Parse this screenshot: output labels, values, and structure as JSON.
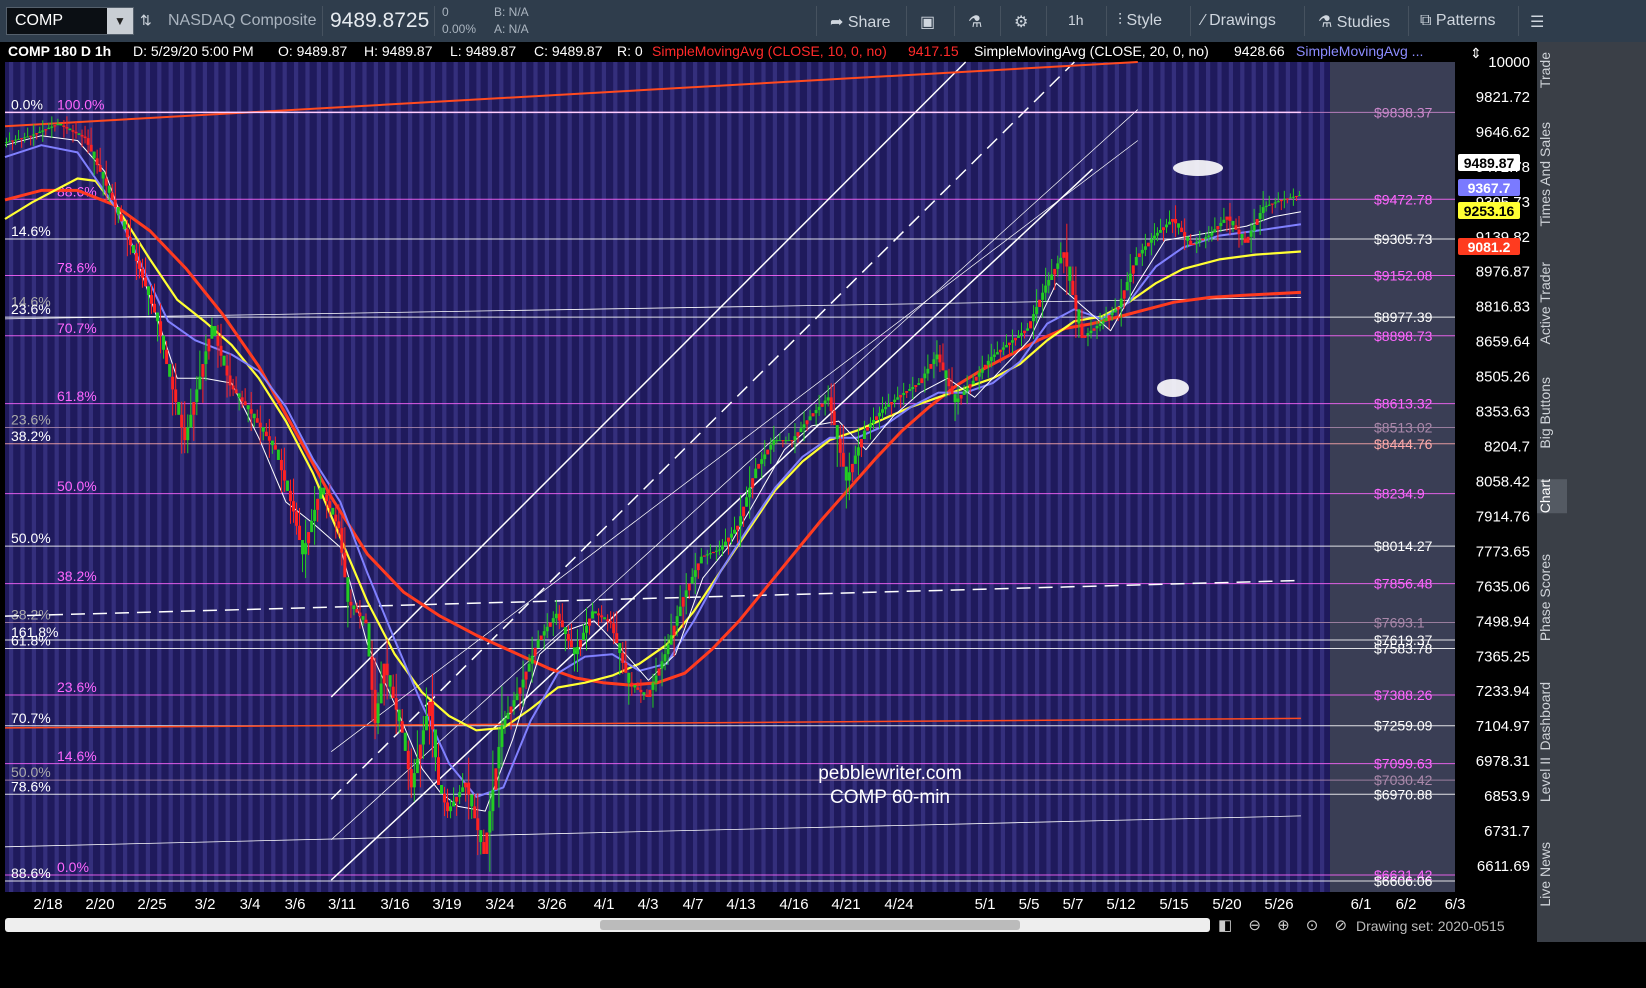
{
  "toolbar": {
    "symbol": "COMP",
    "name": "NASDAQ Composite",
    "price": "9489.8725",
    "change": "0",
    "change_pct": "0.00%",
    "bid": "B: N/A",
    "ask": "A: N/A",
    "share": "Share",
    "interval": "1h",
    "style": "Style",
    "drawings": "Drawings",
    "studies": "Studies",
    "patterns": "Patterns"
  },
  "infobar": {
    "series": "COMP 180 D 1h",
    "date": "D: 5/29/20 5:00 PM",
    "open": "O: 9489.87",
    "high": "H: 9489.87",
    "low": "L: 9489.87",
    "close": "C: 9489.87",
    "range": "R: 0",
    "sma10": "SimpleMovingAvg (CLOSE, 10, 0, no)",
    "sma10_val": "9417.15",
    "sma20": "SimpleMovingAvg (CLOSE, 20, 0, no)",
    "sma20_val": "9428.66",
    "sma_more": "SimpleMovingAvg ..."
  },
  "sidebar": [
    "Trade",
    "Times And Sales",
    "Active Trader",
    "Big Buttons",
    "Chart",
    "Phase Scores",
    "Dashboard",
    "Level II",
    "Live News"
  ],
  "bottombar": {
    "drawing_set": "Drawing set: 2020-0515"
  },
  "chart_data": {
    "type": "line",
    "watermark": [
      "pebblewriter.com",
      "COMP 60-min"
    ],
    "x_ticks": [
      "2/18",
      "2/20",
      "2/25",
      "3/2",
      "3/4",
      "3/6",
      "3/11",
      "3/16",
      "3/19",
      "3/24",
      "3/26",
      "4/1",
      "4/3",
      "4/7",
      "4/13",
      "4/16",
      "4/21",
      "4/24",
      "5/1",
      "5/5",
      "5/7",
      "5/12",
      "5/15",
      "5/20",
      "5/26",
      "6/1",
      "6/2",
      "6/3"
    ],
    "y_ticks": [
      "10000",
      "9821.72",
      "9646.62",
      "9472.78",
      "9305.73",
      "9139.82",
      "8976.87",
      "8816.83",
      "8659.64",
      "8505.26",
      "8353.63",
      "8204.7",
      "8058.42",
      "7914.76",
      "7773.65",
      "7635.06",
      "7498.94",
      "7365.25",
      "7233.94",
      "7104.97",
      "6978.31",
      "6853.9",
      "6731.7",
      "6611.69"
    ],
    "ylim": [
      6560,
      10050
    ],
    "price_labels": [
      {
        "label": "$9838.37",
        "value": 9838.37,
        "color": "#cc88cc"
      },
      {
        "label": "$9472.78",
        "value": 9472.78,
        "color": "#ff66ff"
      },
      {
        "label": "$9305.73",
        "value": 9305.73,
        "color": "#ffffff"
      },
      {
        "label": "$9152.08",
        "value": 9152.08,
        "color": "#ff66ff"
      },
      {
        "label": "$8977.39",
        "value": 8977.39,
        "color": "#ffffff"
      },
      {
        "label": "$8898.73",
        "value": 8898.73,
        "color": "#ff66ff"
      },
      {
        "label": "$8613.32",
        "value": 8613.32,
        "color": "#ff66ff"
      },
      {
        "label": "$8513.02",
        "value": 8513.02,
        "color": "#aa88aa"
      },
      {
        "label": "$8444.76",
        "value": 8444.76,
        "color": "#ffaaaa"
      },
      {
        "label": "$8234.9",
        "value": 8234.9,
        "color": "#ff66ff"
      },
      {
        "label": "$8014.27",
        "value": 8014.27,
        "color": "#ffffff"
      },
      {
        "label": "$7856.48",
        "value": 7856.48,
        "color": "#ff66ff"
      },
      {
        "label": "$7693.1",
        "value": 7693.1,
        "color": "#aa88aa"
      },
      {
        "label": "$7619.37",
        "value": 7619.37,
        "color": "#ffffff"
      },
      {
        "label": "$7583.78",
        "value": 7583.78,
        "color": "#ffffff"
      },
      {
        "label": "$7388.26",
        "value": 7388.26,
        "color": "#ff66ff"
      },
      {
        "label": "$7259.09",
        "value": 7259.09,
        "color": "#ffffff"
      },
      {
        "label": "$7099.63",
        "value": 7099.63,
        "color": "#ff66ff"
      },
      {
        "label": "$7030.42",
        "value": 7030.42,
        "color": "#aa88aa"
      },
      {
        "label": "$6970.88",
        "value": 6970.88,
        "color": "#ffffff"
      },
      {
        "label": "$6631.42",
        "value": 6631.42,
        "color": "#ff66ff"
      },
      {
        "label": "$6606.06",
        "value": 6606.06,
        "color": "#ffffff"
      }
    ],
    "fib_labels": [
      {
        "label": "0.0%",
        "value": 9838,
        "color": "#ffffff"
      },
      {
        "label": "100.0%",
        "value": 9838,
        "color": "#ff66ff"
      },
      {
        "label": "88.6%",
        "value": 9472,
        "color": "#ff66ff"
      },
      {
        "label": "14.6%",
        "value": 9305,
        "color": "#ffffff"
      },
      {
        "label": "78.6%",
        "value": 9152,
        "color": "#ff66ff"
      },
      {
        "label": "14.6%",
        "value": 9010,
        "color": "#aaaaaa"
      },
      {
        "label": "23.6%",
        "value": 8977,
        "color": "#ffffff"
      },
      {
        "label": "70.7%",
        "value": 8898,
        "color": "#ff66ff"
      },
      {
        "label": "61.8%",
        "value": 8613,
        "color": "#ff66ff"
      },
      {
        "label": "23.6%",
        "value": 8513,
        "color": "#aaaaaa"
      },
      {
        "label": "38.2%",
        "value": 8444,
        "color": "#ffffff"
      },
      {
        "label": "50.0%",
        "value": 8234,
        "color": "#ff66ff"
      },
      {
        "label": "50.0%",
        "value": 8014,
        "color": "#ffffff"
      },
      {
        "label": "38.2%",
        "value": 7856,
        "color": "#ff66ff"
      },
      {
        "label": "38.2%",
        "value": 7693,
        "color": "#aaaaaa"
      },
      {
        "label": "161.8%",
        "value": 7619,
        "color": "#ffffff"
      },
      {
        "label": "61.8%",
        "value": 7583,
        "color": "#ffffff"
      },
      {
        "label": "23.6%",
        "value": 7388,
        "color": "#ff66ff"
      },
      {
        "label": "70.7%",
        "value": 7259,
        "color": "#ffffff"
      },
      {
        "label": "14.6%",
        "value": 7099,
        "color": "#ff66ff"
      },
      {
        "label": "50.0%",
        "value": 7030,
        "color": "#aaaaaa"
      },
      {
        "label": "78.6%",
        "value": 6970,
        "color": "#ffffff"
      },
      {
        "label": "0.0%",
        "value": 6631,
        "color": "#ff66ff"
      },
      {
        "label": "88.6%",
        "value": 6606,
        "color": "#ffffff"
      }
    ],
    "badges": [
      {
        "label": "9489.87",
        "value": 9489.87,
        "bg": "#ffffff",
        "fg": "#000000"
      },
      {
        "label": "9367.7",
        "value": 9367.7,
        "bg": "#7a7aff",
        "fg": "#ffffff"
      },
      {
        "label": "9253.16",
        "value": 9253.16,
        "bg": "#ffff33",
        "fg": "#000000"
      },
      {
        "label": "9081.2",
        "value": 9081.2,
        "bg": "#ff3b1f",
        "fg": "#ffffff"
      }
    ],
    "price_series": [
      [
        0,
        9710
      ],
      [
        3,
        9740
      ],
      [
        6,
        9790
      ],
      [
        9,
        9730
      ],
      [
        11,
        9560
      ],
      [
        13,
        9380
      ],
      [
        15,
        9180
      ],
      [
        17,
        8960
      ],
      [
        18,
        8780
      ],
      [
        20,
        8460
      ],
      [
        22,
        8780
      ],
      [
        23,
        8940
      ],
      [
        25,
        8690
      ],
      [
        27,
        8590
      ],
      [
        30,
        8420
      ],
      [
        32,
        8160
      ],
      [
        33,
        7980
      ],
      [
        35,
        8260
      ],
      [
        37,
        8090
      ],
      [
        38,
        7780
      ],
      [
        40,
        7690
      ],
      [
        41,
        7270
      ],
      [
        42,
        7520
      ],
      [
        44,
        7230
      ],
      [
        45,
        7000
      ],
      [
        47,
        7360
      ],
      [
        48,
        7010
      ],
      [
        49,
        6900
      ],
      [
        51,
        7020
      ],
      [
        53,
        6720
      ],
      [
        55,
        7260
      ],
      [
        57,
        7420
      ],
      [
        59,
        7620
      ],
      [
        61,
        7730
      ],
      [
        63,
        7560
      ],
      [
        65,
        7740
      ],
      [
        67,
        7690
      ],
      [
        69,
        7440
      ],
      [
        71,
        7380
      ],
      [
        73,
        7560
      ],
      [
        75,
        7800
      ],
      [
        77,
        7970
      ],
      [
        79,
        8000
      ],
      [
        81,
        8100
      ],
      [
        83,
        8340
      ],
      [
        85,
        8460
      ],
      [
        87,
        8460
      ],
      [
        89,
        8560
      ],
      [
        91,
        8640
      ],
      [
        93,
        8290
      ],
      [
        95,
        8500
      ],
      [
        97,
        8590
      ],
      [
        99,
        8650
      ],
      [
        101,
        8700
      ],
      [
        103,
        8820
      ],
      [
        105,
        8620
      ],
      [
        107,
        8710
      ],
      [
        109,
        8810
      ],
      [
        111,
        8870
      ],
      [
        113,
        8930
      ],
      [
        115,
        9110
      ],
      [
        117,
        9250
      ],
      [
        119,
        8890
      ],
      [
        121,
        8950
      ],
      [
        123,
        9020
      ],
      [
        125,
        9230
      ],
      [
        127,
        9320
      ],
      [
        129,
        9390
      ],
      [
        131,
        9280
      ],
      [
        133,
        9320
      ],
      [
        135,
        9400
      ],
      [
        137,
        9290
      ],
      [
        139,
        9440
      ],
      [
        141,
        9470
      ],
      [
        143,
        9490
      ]
    ],
    "sma_fast": [
      [
        0,
        9700
      ],
      [
        4,
        9740
      ],
      [
        8,
        9720
      ],
      [
        11,
        9590
      ],
      [
        14,
        9280
      ],
      [
        17,
        8950
      ],
      [
        19,
        8720
      ],
      [
        22,
        8720
      ],
      [
        25,
        8700
      ],
      [
        28,
        8470
      ],
      [
        31,
        8200
      ],
      [
        34,
        8110
      ],
      [
        37,
        8010
      ],
      [
        40,
        7600
      ],
      [
        43,
        7350
      ],
      [
        46,
        7080
      ],
      [
        48,
        6980
      ],
      [
        50,
        6920
      ],
      [
        53,
        6900
      ],
      [
        56,
        7200
      ],
      [
        59,
        7560
      ],
      [
        62,
        7660
      ],
      [
        65,
        7700
      ],
      [
        68,
        7580
      ],
      [
        71,
        7450
      ],
      [
        74,
        7560
      ],
      [
        77,
        7880
      ],
      [
        80,
        8020
      ],
      [
        83,
        8220
      ],
      [
        86,
        8420
      ],
      [
        89,
        8520
      ],
      [
        92,
        8540
      ],
      [
        95,
        8420
      ],
      [
        98,
        8560
      ],
      [
        101,
        8660
      ],
      [
        104,
        8720
      ],
      [
        107,
        8640
      ],
      [
        110,
        8760
      ],
      [
        113,
        8880
      ],
      [
        116,
        9120
      ],
      [
        119,
        9020
      ],
      [
        122,
        8920
      ],
      [
        125,
        9120
      ],
      [
        128,
        9300
      ],
      [
        131,
        9320
      ],
      [
        134,
        9340
      ],
      [
        137,
        9360
      ],
      [
        140,
        9400
      ],
      [
        143,
        9420
      ]
    ],
    "sma_20": [
      [
        0,
        9650
      ],
      [
        4,
        9700
      ],
      [
        8,
        9670
      ],
      [
        12,
        9450
      ],
      [
        15,
        9200
      ],
      [
        18,
        8960
      ],
      [
        21,
        8880
      ],
      [
        25,
        8820
      ],
      [
        28,
        8750
      ],
      [
        31,
        8600
      ],
      [
        34,
        8380
      ],
      [
        37,
        8200
      ],
      [
        40,
        7900
      ],
      [
        43,
        7620
      ],
      [
        46,
        7350
      ],
      [
        49,
        7100
      ],
      [
        52,
        6960
      ],
      [
        55,
        7000
      ],
      [
        58,
        7280
      ],
      [
        61,
        7480
      ],
      [
        64,
        7550
      ],
      [
        67,
        7560
      ],
      [
        70,
        7490
      ],
      [
        73,
        7520
      ],
      [
        76,
        7700
      ],
      [
        79,
        7910
      ],
      [
        82,
        8090
      ],
      [
        85,
        8260
      ],
      [
        88,
        8390
      ],
      [
        91,
        8470
      ],
      [
        94,
        8470
      ],
      [
        97,
        8520
      ],
      [
        100,
        8600
      ],
      [
        103,
        8660
      ],
      [
        106,
        8660
      ],
      [
        109,
        8700
      ],
      [
        112,
        8790
      ],
      [
        115,
        8950
      ],
      [
        118,
        9010
      ],
      [
        121,
        8970
      ],
      [
        124,
        9040
      ],
      [
        127,
        9190
      ],
      [
        130,
        9270
      ],
      [
        134,
        9320
      ],
      [
        138,
        9340
      ],
      [
        143,
        9368
      ]
    ],
    "sma_yellow": [
      [
        0,
        9390
      ],
      [
        3,
        9460
      ],
      [
        6,
        9520
      ],
      [
        8,
        9560
      ],
      [
        10,
        9550
      ],
      [
        13,
        9400
      ],
      [
        16,
        9220
      ],
      [
        19,
        9050
      ],
      [
        22,
        8960
      ],
      [
        25,
        8860
      ],
      [
        28,
        8720
      ],
      [
        31,
        8540
      ],
      [
        34,
        8320
      ],
      [
        37,
        8050
      ],
      [
        40,
        7780
      ],
      [
        43,
        7560
      ],
      [
        46,
        7400
      ],
      [
        49,
        7300
      ],
      [
        52,
        7240
      ],
      [
        55,
        7250
      ],
      [
        58,
        7330
      ],
      [
        61,
        7420
      ],
      [
        64,
        7440
      ],
      [
        67,
        7470
      ],
      [
        70,
        7520
      ],
      [
        73,
        7600
      ],
      [
        76,
        7740
      ],
      [
        79,
        7910
      ],
      [
        82,
        8080
      ],
      [
        85,
        8250
      ],
      [
        88,
        8370
      ],
      [
        91,
        8460
      ],
      [
        94,
        8500
      ],
      [
        97,
        8550
      ],
      [
        100,
        8600
      ],
      [
        103,
        8640
      ],
      [
        106,
        8680
      ],
      [
        109,
        8720
      ],
      [
        112,
        8780
      ],
      [
        115,
        8880
      ],
      [
        118,
        8960
      ],
      [
        121,
        8980
      ],
      [
        124,
        9040
      ],
      [
        127,
        9120
      ],
      [
        130,
        9180
      ],
      [
        134,
        9220
      ],
      [
        138,
        9240
      ],
      [
        143,
        9253
      ]
    ],
    "sma_red": [
      [
        0,
        9470
      ],
      [
        4,
        9510
      ],
      [
        8,
        9510
      ],
      [
        12,
        9450
      ],
      [
        16,
        9340
      ],
      [
        20,
        9180
      ],
      [
        24,
        8990
      ],
      [
        28,
        8770
      ],
      [
        32,
        8500
      ],
      [
        36,
        8220
      ],
      [
        40,
        7980
      ],
      [
        44,
        7820
      ],
      [
        48,
        7720
      ],
      [
        52,
        7640
      ],
      [
        56,
        7570
      ],
      [
        60,
        7500
      ],
      [
        63,
        7460
      ],
      [
        66,
        7440
      ],
      [
        69,
        7430
      ],
      [
        72,
        7440
      ],
      [
        75,
        7480
      ],
      [
        78,
        7580
      ],
      [
        81,
        7700
      ],
      [
        84,
        7840
      ],
      [
        87,
        7980
      ],
      [
        90,
        8120
      ],
      [
        93,
        8250
      ],
      [
        96,
        8380
      ],
      [
        99,
        8500
      ],
      [
        102,
        8600
      ],
      [
        105,
        8690
      ],
      [
        108,
        8760
      ],
      [
        111,
        8820
      ],
      [
        114,
        8880
      ],
      [
        117,
        8930
      ],
      [
        120,
        8950
      ],
      [
        123,
        8980
      ],
      [
        126,
        9010
      ],
      [
        129,
        9040
      ],
      [
        133,
        9060
      ],
      [
        137,
        9070
      ],
      [
        143,
        9081
      ]
    ]
  }
}
